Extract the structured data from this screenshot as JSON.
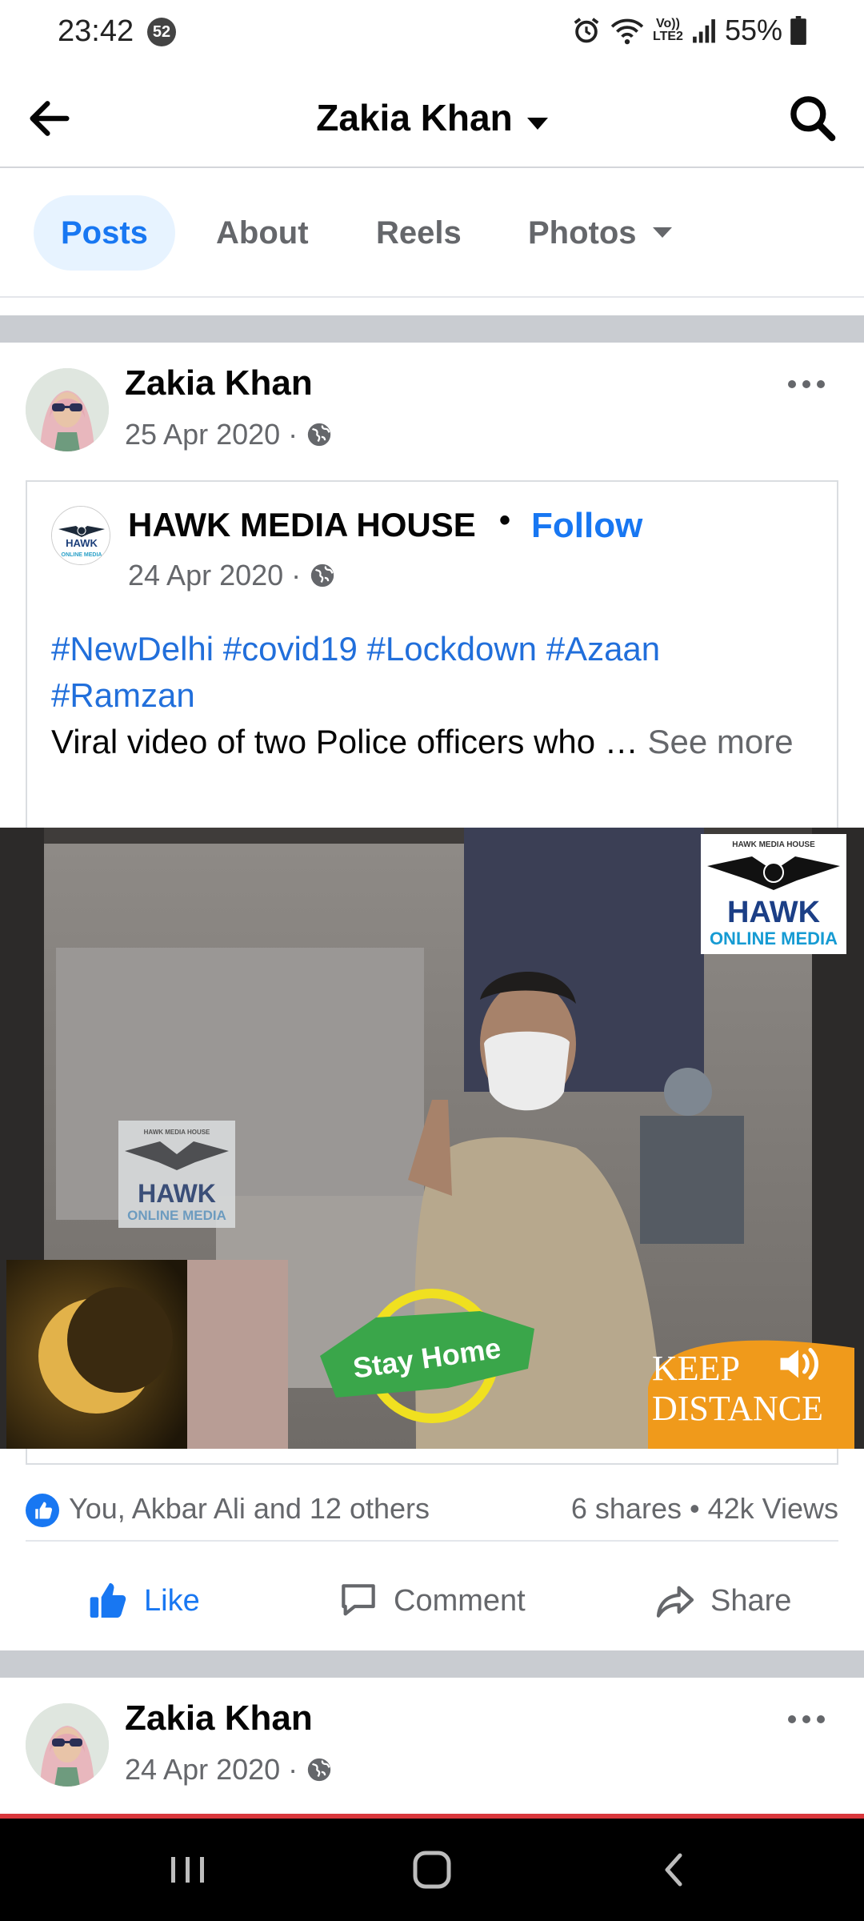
{
  "status_bar": {
    "time": "23:42",
    "notification_count": "52",
    "network_top": "Vo))",
    "network_bottom": "LTE2",
    "battery": "55%",
    "icons": [
      "alarm-icon",
      "wifi-icon",
      "signal-icon",
      "battery-icon"
    ]
  },
  "app_bar": {
    "title": "Zakia Khan",
    "back_icon": "arrow-left-icon",
    "search_icon": "search-icon"
  },
  "tabs": [
    {
      "label": "Posts",
      "active": true
    },
    {
      "label": "About",
      "active": false
    },
    {
      "label": "Reels",
      "active": false
    },
    {
      "label": "Photos",
      "active": false
    }
  ],
  "post": {
    "author": "Zakia Khan",
    "date": "25 Apr 2020",
    "date_separator": "·",
    "audience_icon": "globe-icon",
    "shared": {
      "page_name": "HAWK MEDIA HOUSE",
      "separator": "•",
      "follow_label": "Follow",
      "date": "24 Apr 2020",
      "date_separator": "·",
      "hashtags_line1": "#NewDelhi #covid19 #Lockdown #Azaan",
      "hashtags_line2": "#Ramzan",
      "text": "Viral video of two Police officers who … ",
      "see_more": "See more",
      "logo_text": "HAWK",
      "logo_subtext": "ONLINE MEDIA"
    },
    "media": {
      "watermark_top_small": "HAWK MEDIA HOUSE",
      "watermark_top": "HAWK",
      "watermark_top_sub": "ONLINE MEDIA",
      "watermark_mid": "HAWK",
      "watermark_mid_sub": "ONLINE MEDIA",
      "watermark_mid_small": "HAWK MEDIA HOUSE",
      "stay_home": "Stay  Home",
      "keep": "KEEP",
      "distance": "DISTANCE"
    },
    "reactions": "You, Akbar Ali and 12 others",
    "stats": "6 shares • 42k Views",
    "actions": {
      "like": "Like",
      "comment": "Comment",
      "share": "Share"
    }
  },
  "next_post": {
    "author": "Zakia Khan",
    "date": "24 Apr 2020",
    "date_separator": "·"
  },
  "colors": {
    "accent": "#1877f2",
    "hashtag": "#216fdb",
    "muted": "#65676b",
    "separator": "#c9ccd1"
  }
}
